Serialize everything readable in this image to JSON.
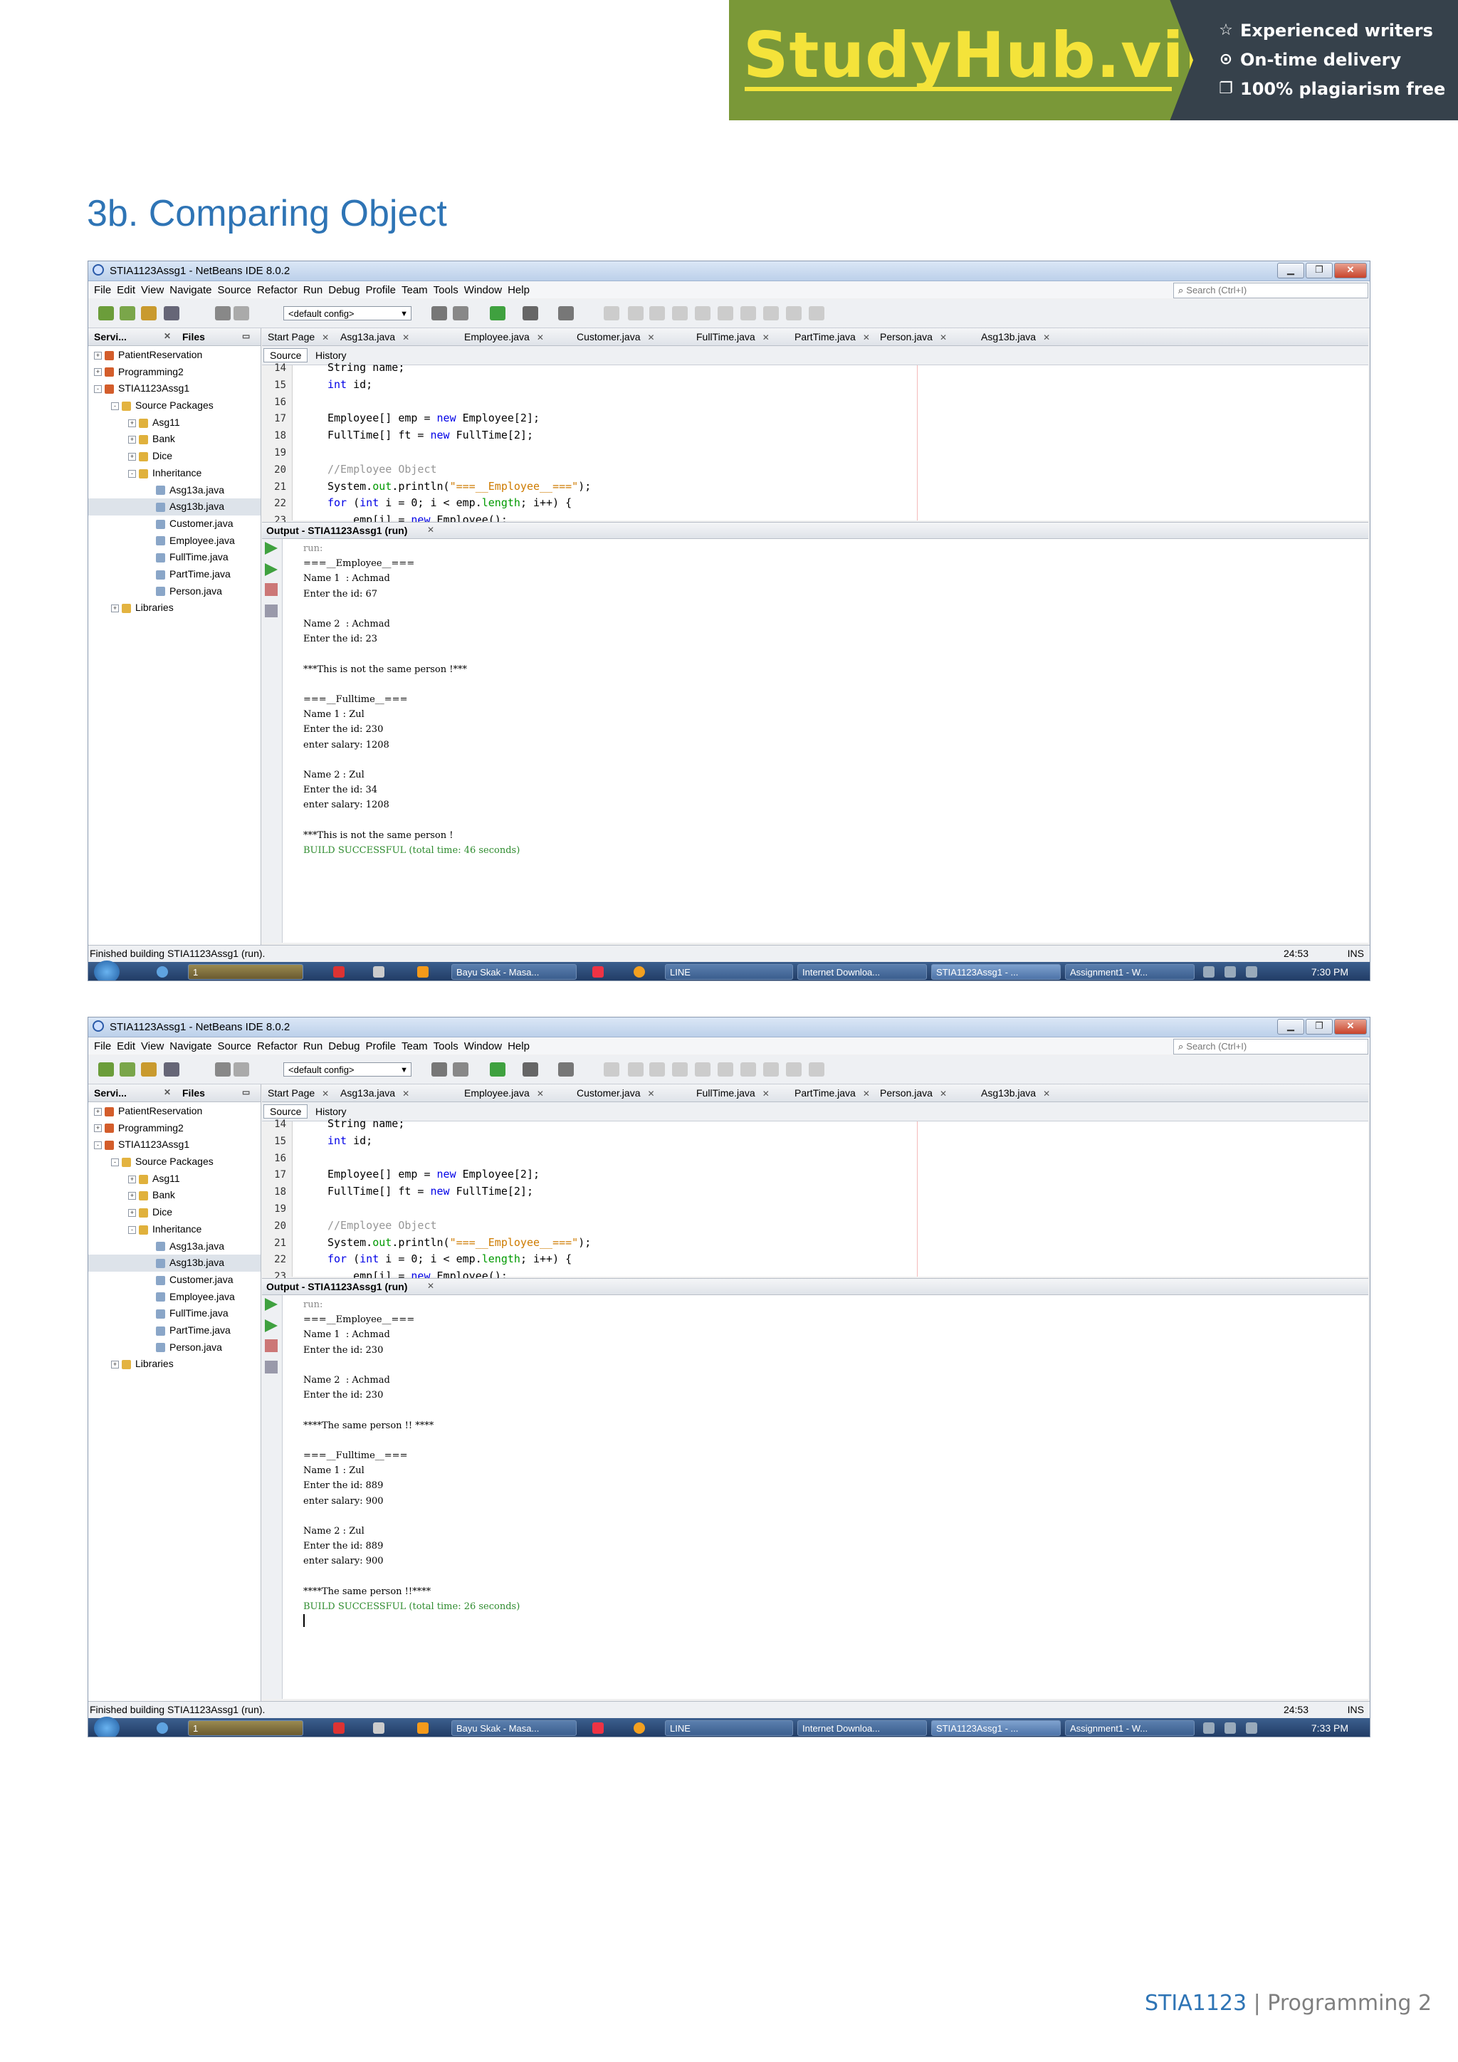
{
  "banner": {
    "logo": "StudyHub.vip",
    "features": [
      {
        "icon": "star-icon",
        "label": "Experienced writers"
      },
      {
        "icon": "clock-icon",
        "label": "On-time delivery"
      },
      {
        "icon": "document-icon",
        "label": "100% plagiarism free"
      }
    ],
    "colors": {
      "logo_bg": "#7a9838",
      "logo_text": "#f4e33a",
      "bg": "#36414b"
    }
  },
  "section_title": "3b. Comparing Object",
  "ide": {
    "title": "STIA1123Assg1 - NetBeans IDE 8.0.2",
    "menu": [
      "File",
      "Edit",
      "View",
      "Navigate",
      "Source",
      "Refactor",
      "Run",
      "Debug",
      "Profile",
      "Team",
      "Tools",
      "Window",
      "Help"
    ],
    "search_placeholder": "Search (Ctrl+I)",
    "config": "<default config>",
    "left_tabs": [
      "Servi...",
      "Files"
    ],
    "tree": [
      {
        "label": "PatientReservation",
        "level": 0,
        "icon": "project-icon",
        "exp": "+"
      },
      {
        "label": "Programming2",
        "level": 0,
        "icon": "project-icon",
        "exp": "+"
      },
      {
        "label": "STIA1123Assg1",
        "level": 0,
        "icon": "project-icon",
        "exp": "-"
      },
      {
        "label": "Source Packages",
        "level": 1,
        "icon": "folder-icon",
        "exp": "-"
      },
      {
        "label": "Asg11",
        "level": 2,
        "icon": "package-icon",
        "exp": "+"
      },
      {
        "label": "Bank",
        "level": 2,
        "icon": "package-icon",
        "exp": "+"
      },
      {
        "label": "Dice",
        "level": 2,
        "icon": "package-icon",
        "exp": "+"
      },
      {
        "label": "Inheritance",
        "level": 2,
        "icon": "package-icon",
        "exp": "-"
      },
      {
        "label": "Asg13a.java",
        "level": 3,
        "icon": "java-file-icon",
        "exp": ""
      },
      {
        "label": "Asg13b.java",
        "level": 3,
        "icon": "java-file-icon",
        "exp": "",
        "selected": true
      },
      {
        "label": "Customer.java",
        "level": 3,
        "icon": "java-file-icon",
        "exp": ""
      },
      {
        "label": "Employee.java",
        "level": 3,
        "icon": "java-file-icon",
        "exp": ""
      },
      {
        "label": "FullTime.java",
        "level": 3,
        "icon": "java-file-icon",
        "exp": ""
      },
      {
        "label": "PartTime.java",
        "level": 3,
        "icon": "java-file-icon",
        "exp": ""
      },
      {
        "label": "Person.java",
        "level": 3,
        "icon": "java-file-icon",
        "exp": ""
      },
      {
        "label": "Libraries",
        "level": 1,
        "icon": "folder-icon",
        "exp": "+"
      }
    ],
    "editor_tabs": [
      "Start Page",
      "Asg13a.java",
      "Employee.java",
      "Customer.java",
      "FullTime.java",
      "PartTime.java",
      "Person.java",
      "Asg13b.java"
    ],
    "source_btn": "Source",
    "history_btn": "History",
    "code_lines": [
      {
        "n": "14",
        "text": "String name;"
      },
      {
        "n": "15",
        "text": "int id;"
      },
      {
        "n": "16",
        "text": ""
      },
      {
        "n": "17",
        "text": "Employee[] emp = new Employee[2];"
      },
      {
        "n": "18",
        "text": "FullTime[] ft = new FullTime[2];"
      },
      {
        "n": "19",
        "text": ""
      },
      {
        "n": "20",
        "text": "//Employee Object"
      },
      {
        "n": "21",
        "text": "System.out.println(\"===__Employee__===\");"
      },
      {
        "n": "22",
        "text": "for (int i = 0; i < emp.length; i++) {"
      },
      {
        "n": "23",
        "text": "    emp[i] = new Employee();"
      }
    ],
    "output_tab": "Output - STIA1123Assg1 (run)",
    "status_text": "Finished building STIA1123Assg1 (run).",
    "cursor_pos": "24:53",
    "ins": "INS",
    "taskbar_items": [
      "1",
      "Bayu Skak - Masa...",
      "LINE",
      "Internet Downloa...",
      "STIA1123Assg1 - ...",
      "Assignment1 - W..."
    ]
  },
  "screens": [
    {
      "output_lines": [
        "run:",
        "===__Employee__===",
        "Name 1  : Achmad",
        "Enter the id: 67",
        "",
        "Name 2  : Achmad",
        "Enter the id: 23",
        "",
        "***This is not the same person !***",
        "",
        "===__Fulltime__===",
        "Name 1 : Zul",
        "Enter the id: 230",
        "enter salary: 1208",
        "",
        "Name 2 : Zul",
        "Enter the id: 34",
        "enter salary: 1208",
        "",
        "***This is not the same person !",
        "BUILD SUCCESSFUL (total time: 46 seconds)"
      ],
      "clock": "7:30 PM"
    },
    {
      "output_lines": [
        "run:",
        "===__Employee__===",
        "Name 1  : Achmad",
        "Enter the id: 230",
        "",
        "Name 2  : Achmad",
        "Enter the id: 230",
        "",
        "****The same person !! ****",
        "",
        "===__Fulltime__===",
        "Name 1 : Zul",
        "Enter the id: 889",
        "enter salary: 900",
        "",
        "Name 2 : Zul",
        "Enter the id: 889",
        "enter salary: 900",
        "",
        "****The same person !!****",
        "BUILD SUCCESSFUL (total time: 26 seconds)"
      ],
      "clock": "7:33 PM"
    }
  ],
  "footer": {
    "code": "STIA1123",
    "sep": " | ",
    "name": "Programming 2"
  }
}
